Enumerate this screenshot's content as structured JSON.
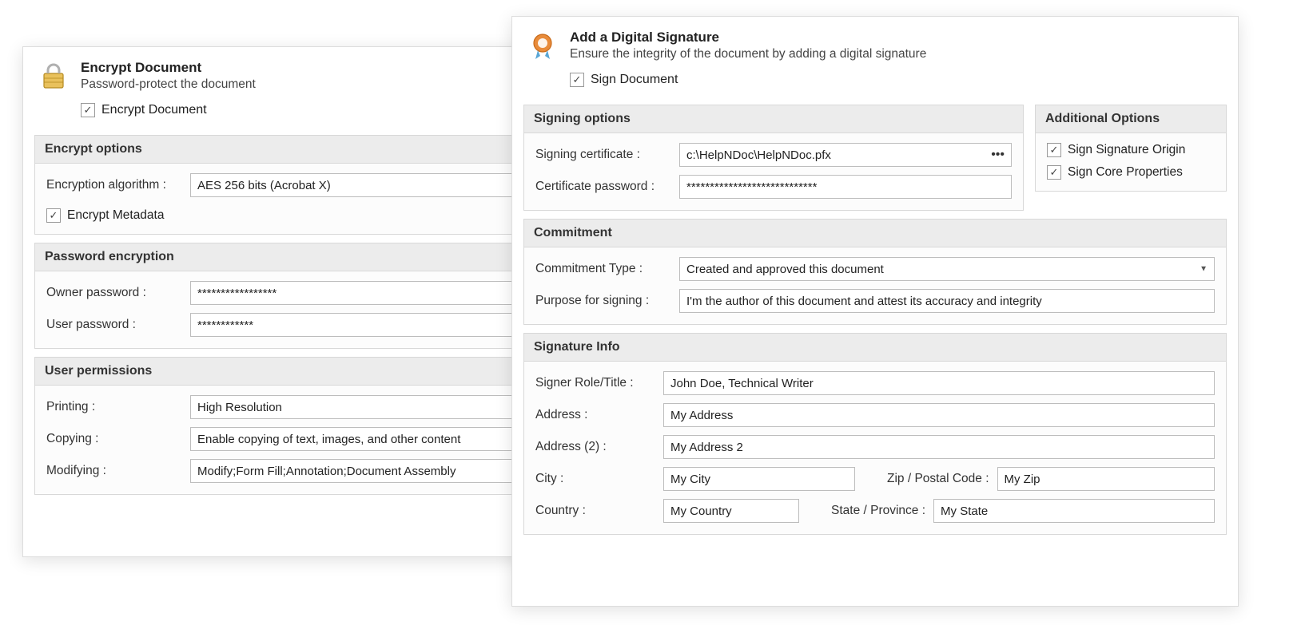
{
  "encrypt": {
    "title": "Encrypt Document",
    "subtitle": "Password-protect the document",
    "checkbox_label": "Encrypt Document"
  },
  "encrypt_options": {
    "header": "Encrypt options",
    "algo_label": "Encryption algorithm :",
    "algo_value": "AES 256 bits (Acrobat X)",
    "metadata_label": "Encrypt Metadata"
  },
  "password_enc": {
    "header": "Password encryption",
    "owner_label": "Owner password :",
    "owner_value": "*****************",
    "user_label": "User password :",
    "user_value": "************"
  },
  "permissions": {
    "header": "User permissions",
    "printing_label": "Printing :",
    "printing_value": "High Resolution",
    "copying_label": "Copying :",
    "copying_value": "Enable copying of text, images, and other content",
    "modifying_label": "Modifying :",
    "modifying_value": "Modify;Form Fill;Annotation;Document Assembly"
  },
  "sign": {
    "title": "Add a Digital Signature",
    "subtitle": "Ensure the integrity of the document by adding a digital signature",
    "checkbox_label": "Sign Document"
  },
  "signing_options": {
    "header": "Signing options",
    "cert_label": "Signing certificate :",
    "cert_value": "c:\\HelpNDoc\\HelpNDoc.pfx",
    "pwd_label": "Certificate password :",
    "pwd_value": "****************************"
  },
  "additional": {
    "header": "Additional Options",
    "origin_label": "Sign Signature Origin",
    "core_label": "Sign Core Properties"
  },
  "commitment": {
    "header": "Commitment",
    "type_label": "Commitment Type :",
    "type_value": "Created and approved this document",
    "purpose_label": "Purpose for signing :",
    "purpose_value": "I'm the author of this document and attest its accuracy and integrity"
  },
  "siginfo": {
    "header": "Signature Info",
    "role_label": "Signer Role/Title :",
    "role_value": "John Doe, Technical Writer",
    "addr_label": "Address :",
    "addr_value": "My Address",
    "addr2_label": "Address (2) :",
    "addr2_value": "My Address 2",
    "city_label": "City :",
    "city_value": "My City",
    "zip_label": "Zip / Postal Code :",
    "zip_value": "My Zip",
    "country_label": "Country :",
    "country_value": "My Country",
    "state_label": "State / Province :",
    "state_value": "My State"
  }
}
